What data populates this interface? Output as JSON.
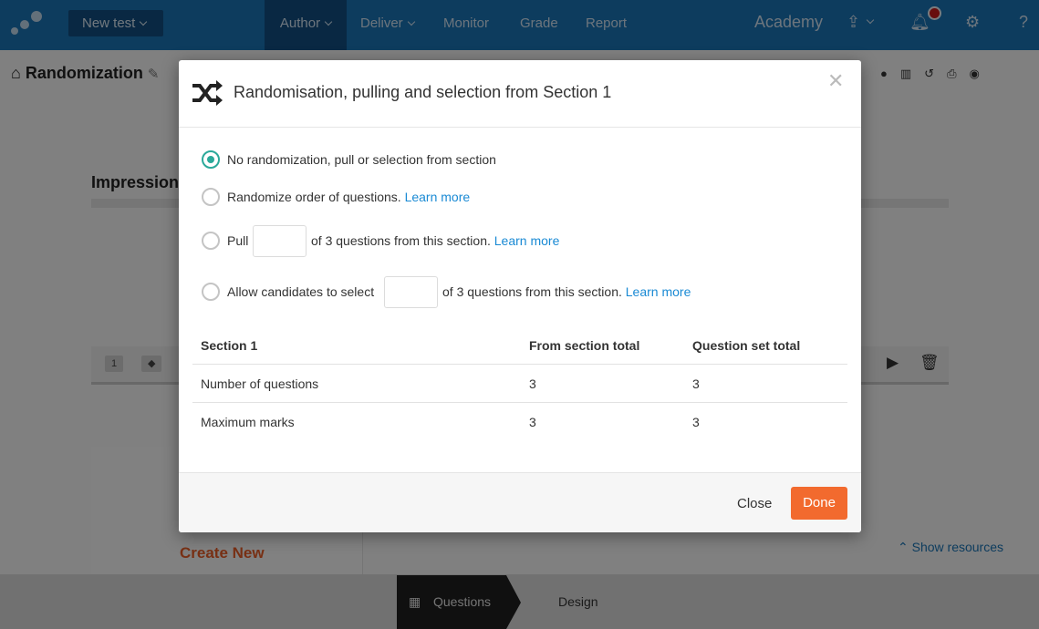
{
  "topnav": {
    "new_test": "New test",
    "items": [
      "Author",
      "Deliver",
      "Monitor",
      "Grade",
      "Report"
    ],
    "academy": "Academy"
  },
  "page": {
    "title": "Randomization",
    "section_heading": "Impression",
    "question_number": "1",
    "create_new": "Create New",
    "show_resources": "Show resources",
    "tabs": [
      "Questions",
      "Design"
    ]
  },
  "modal": {
    "title": "Randomisation, pulling and selection from Section 1",
    "options": {
      "none": "No randomization, pull or selection from section",
      "randomize": "Randomize order of questions.",
      "pull_prefix": "Pull",
      "pull_suffix": "of 3 questions from this section.",
      "select_prefix": "Allow candidates to select",
      "select_suffix": "of 3 questions from this section.",
      "learn_more": "Learn more"
    },
    "table": {
      "headers": [
        "Section 1",
        "From section total",
        "Question set total"
      ],
      "rows": [
        [
          "Number of questions",
          "3",
          "3"
        ],
        [
          "Maximum marks",
          "3",
          "3"
        ]
      ]
    },
    "close_label": "Close",
    "done_label": "Done"
  },
  "colors": {
    "nav": "#1a73b4",
    "accent_radio": "#2ba99a",
    "link": "#1a8ad4",
    "done": "#f26a2e",
    "notification": "#c81a1a"
  }
}
